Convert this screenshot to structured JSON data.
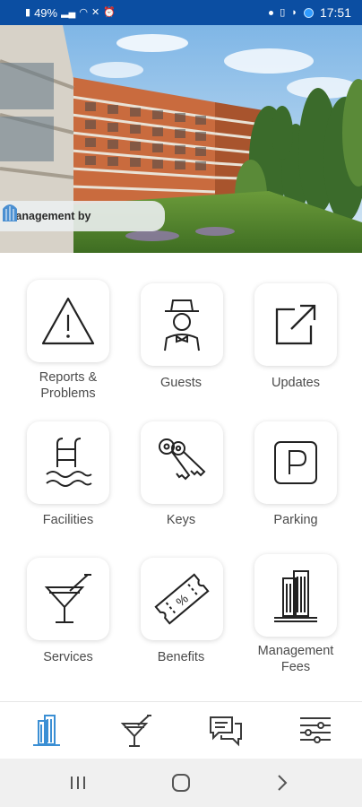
{
  "status_bar": {
    "battery": "49%",
    "time": "17:51"
  },
  "hero": {
    "management_label": "Management by",
    "logo_icon": "building-dome-logo"
  },
  "grid": {
    "items": [
      {
        "label": "Reports & Problems",
        "icon": "warning-triangle-icon"
      },
      {
        "label": "Guests",
        "icon": "guest-person-icon"
      },
      {
        "label": "Updates",
        "icon": "external-link-icon"
      },
      {
        "label": "Facilities",
        "icon": "pool-ladder-icon"
      },
      {
        "label": "Keys",
        "icon": "keys-icon"
      },
      {
        "label": "Parking",
        "icon": "parking-icon"
      },
      {
        "label": "Services",
        "icon": "cocktail-icon"
      },
      {
        "label": "Benefits",
        "icon": "discount-ticket-icon"
      },
      {
        "label": "Management Fees",
        "icon": "building-icon"
      }
    ]
  },
  "bottom_nav": {
    "active_index": 0,
    "items": [
      "building-icon",
      "cocktail-icon",
      "chat-bubbles-icon",
      "sliders-icon"
    ],
    "active_color": "#3b8fd4",
    "inactive_color": "#3a3a3a"
  }
}
